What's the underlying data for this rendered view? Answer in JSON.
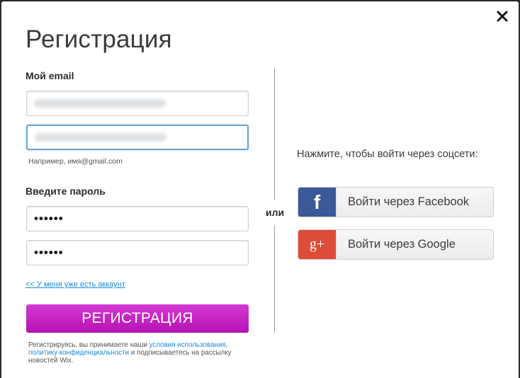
{
  "dialog": {
    "title": "Регистрация",
    "close_label": "✕"
  },
  "email": {
    "label": "Мой email",
    "hint": "Например, имя@gmail.com"
  },
  "password": {
    "label": "Введите пароль",
    "value": "••••••",
    "confirm_value": "••••••"
  },
  "login_link": "<< У меня уже есть аккаунт",
  "register_button": "РЕГИСТРАЦИЯ",
  "terms": {
    "prefix": "Регистрируясь, вы принимаете наши ",
    "terms_link": "условия использования",
    "comma": ",",
    "privacy_link": "политику конфиденциальности",
    "suffix": " и подписываетесь на рассылку новостей Wix."
  },
  "divider": {
    "or_text": "или"
  },
  "social": {
    "prompt": "Нажмите, чтобы войти через соцсети:",
    "facebook": {
      "icon": "f",
      "label": "Войти через Facebook",
      "color": "#3b5998"
    },
    "google": {
      "icon": "g+",
      "label": "Войти через Google",
      "color": "#dd4b39"
    }
  },
  "colors": {
    "accent": "#c020be",
    "link": "#1a8be0",
    "focus": "#68a8d8"
  }
}
